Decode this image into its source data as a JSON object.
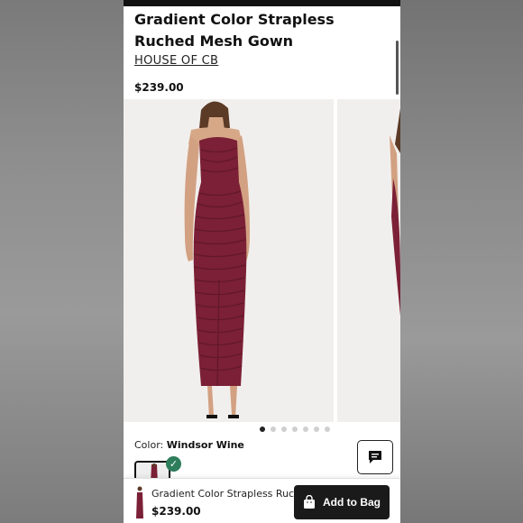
{
  "product": {
    "title": "Gradient Color Strapless Ruched Mesh Gown",
    "brand": "HOUSE OF CB",
    "price": "$239.00"
  },
  "gallery": {
    "image_count": 7,
    "active_index": 0
  },
  "color": {
    "label": "Color:",
    "value": "Windsor Wine",
    "swatch_hex": "#7a1f33"
  },
  "bottom_bar": {
    "name": "Gradient Color Strapless Ruch...",
    "price": "$239.00",
    "add_button": "Add to Bag"
  },
  "colors": {
    "dress": "#7b2036",
    "dress_dark": "#5a1426",
    "skin": "#d7a888",
    "button": "#1a1a1a",
    "check": "#2e7d5b"
  },
  "icons": [
    "chat-icon",
    "bag-icon",
    "check-icon"
  ]
}
